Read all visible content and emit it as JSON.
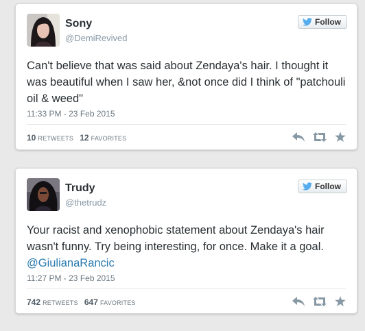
{
  "tweets": [
    {
      "name": "Sony",
      "handle": "@DemiRevived",
      "follow_label": "Follow",
      "text": "Can't believe that was said about Zendaya's hair. I thought it was beautiful when I saw her, &not once did I think of \"patchouli oil & weed\"",
      "timestamp": "11:33 PM - 23 Feb 2015",
      "retweets": "10",
      "retweets_label": "RETWEETS",
      "favorites": "12",
      "favorites_label": "FAVORITES"
    },
    {
      "name": "Trudy",
      "handle": "@thetrudz",
      "follow_label": "Follow",
      "text": "Your racist and xenophobic statement about Zendaya's hair wasn't funny. Try being interesting, for once. Make it a goal.",
      "mention": "@GiulianaRancic",
      "timestamp": "11:27 PM - 23 Feb 2015",
      "retweets": "742",
      "retweets_label": "RETWEETS",
      "favorites": "647",
      "favorites_label": "FAVORITES"
    }
  ],
  "icons": {
    "follow": "twitter-bird-icon",
    "reply": "reply-icon",
    "retweet": "retweet-icon",
    "favorite": "star-icon"
  },
  "colors": {
    "accent": "#2a7ab0",
    "twitter_blue": "#55acee",
    "action_gray": "#8899a6"
  }
}
